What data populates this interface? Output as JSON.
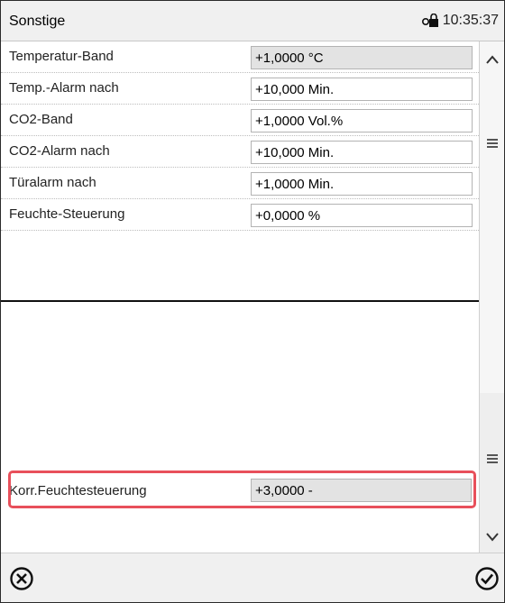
{
  "header": {
    "title": "Sonstige",
    "time": "10:35:37",
    "lock_icon": "lock-icon"
  },
  "settings": [
    {
      "label": "Temperatur-Band",
      "value": "+1,0000 °C",
      "readonly": true
    },
    {
      "label": "Temp.-Alarm nach",
      "value": "+10,000 Min.",
      "readonly": false
    },
    {
      "label": "CO2-Band",
      "value": "+1,0000 Vol.%",
      "readonly": false
    },
    {
      "label": "CO2-Alarm nach",
      "value": "+10,000 Min.",
      "readonly": false
    },
    {
      "label": "Türalarm nach",
      "value": "+1,0000 Min.",
      "readonly": false
    },
    {
      "label": "Feuchte-Steuerung",
      "value": "+0,0000 %",
      "readonly": false
    }
  ],
  "bottom_setting": {
    "label": "Korr.Feuchtesteuerung",
    "value": "+3,0000 -",
    "readonly": true
  },
  "scrollbar": {
    "up_icon": "chevron-up-icon",
    "handle_icon": "menu-icon",
    "down_icon": "chevron-down-icon"
  },
  "footer": {
    "cancel_icon": "close-circle-icon",
    "confirm_icon": "check-circle-icon"
  },
  "colors": {
    "highlight": "#e8505b",
    "readonly_field": "#e3e3e3"
  }
}
